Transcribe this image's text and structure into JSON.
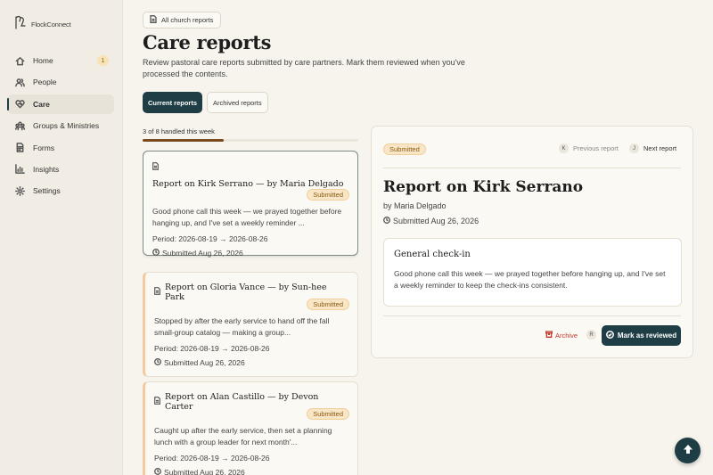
{
  "app": {
    "brand": "FlockConnect"
  },
  "sidebar": {
    "items": [
      {
        "label": "Home",
        "icon": "home-icon",
        "badge": "1"
      },
      {
        "label": "People",
        "icon": "people-icon"
      },
      {
        "label": "Care",
        "icon": "heart-icon",
        "active": true
      },
      {
        "label": "Groups & Ministries",
        "icon": "groups-icon"
      },
      {
        "label": "Forms",
        "icon": "forms-icon"
      },
      {
        "label": "Insights",
        "icon": "chart-icon"
      },
      {
        "label": "Settings",
        "icon": "gear-icon"
      }
    ]
  },
  "breadcrumb": {
    "label": "All church reports"
  },
  "page": {
    "title": "Care reports",
    "description": "Review pastoral care reports submitted by care partners. Mark them reviewed when you've processed the contents."
  },
  "tabs": [
    {
      "label": "Current reports",
      "active": true
    },
    {
      "label": "Archived reports",
      "active": false
    }
  ],
  "progress": {
    "label": "3 of 8 handled this week",
    "handled": 3,
    "total": 8
  },
  "reports": [
    {
      "title": "Report on Kirk Serrano — by Maria Delgado",
      "status": "Submitted",
      "excerpt": "Good phone call this week — we prayed together before hanging up, and I've set a weekly reminder ...",
      "period": "Period: 2026-08-19 → 2026-08-26",
      "submitted": "Submitted Aug 26, 2026"
    },
    {
      "title": "Report on Gloria Vance — by Sun-hee Park",
      "status": "Submitted",
      "excerpt": "Stopped by after the early service to hand off the fall small-group catalog — making a group...",
      "period": "Period: 2026-08-19 → 2026-08-26",
      "submitted": "Submitted Aug 26, 2026"
    },
    {
      "title": "Report on Alan Castillo — by Devon Carter",
      "status": "Submitted",
      "excerpt": "Caught up after the early service, then set a planning lunch with a group leader for next month'...",
      "period": "Period: 2026-08-19 → 2026-08-26",
      "submitted": "Submitted Aug 26, 2026"
    }
  ],
  "detail": {
    "status": "Submitted",
    "prev_key": "K",
    "prev_label": "Previous report",
    "next_key": "J",
    "next_label": "Next report",
    "title": "Report on Kirk Serrano",
    "author": "by Maria Delgado",
    "submitted": "Submitted Aug 26, 2026",
    "section_title": "General check-in",
    "section_body": "Good phone call this week — we prayed together before hanging up, and I've set a weekly reminder to keep the check-ins consistent.",
    "archive_label": "Archive",
    "archive_key": "R",
    "review_label": "Mark as reviewed"
  },
  "colors": {
    "primary": "#1f3d45",
    "accent_pill": "#f9e6c6",
    "progress": "#7a4a1e",
    "danger": "#c0392b"
  }
}
